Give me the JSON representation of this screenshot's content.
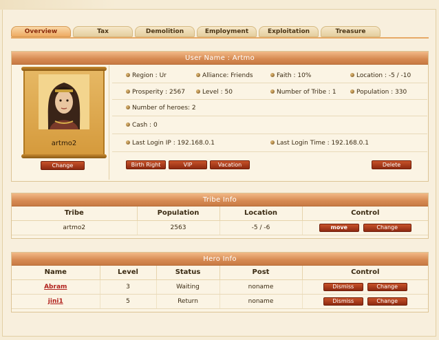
{
  "tabs": [
    "Overview",
    "Tax",
    "Demolition",
    "Employment",
    "Exploitation",
    "Treasure"
  ],
  "user_panel": {
    "header": "User Name : Artmo",
    "player_name": "artmo2",
    "change_label": "Change",
    "fields": {
      "region": "Region : Ur",
      "alliance": "Alliance: Friends",
      "faith": "Faith : 10%",
      "location": "Location : -5 / -10",
      "prosperity": "Prosperity : 2567",
      "level": "Level : 50",
      "num_tribe": "Number of Tribe : 1",
      "population": "Population : 330",
      "heroes": "Number of heroes: 2",
      "cash": "Cash : 0",
      "last_ip": "Last Login IP : 192.168.0.1",
      "last_time": "Last Login Time : 192.168.0.1"
    },
    "buttons": {
      "birth_right": "Birth Right",
      "vip": "VIP",
      "vacation": "Vacation",
      "delete": "Delete"
    }
  },
  "tribe_panel": {
    "header": "Tribe Info",
    "columns": [
      "Tribe",
      "Population",
      "Location",
      "Control"
    ],
    "rows": [
      {
        "tribe": "artmo2",
        "population": "2563",
        "location": "-5 / -6",
        "move": "move",
        "change": "Change"
      }
    ]
  },
  "hero_panel": {
    "header": "Hero Info",
    "columns": [
      "Name",
      "Level",
      "Status",
      "Post",
      "Control"
    ],
    "rows": [
      {
        "name": "Abram",
        "level": "3",
        "status": "Waiting",
        "post": "noname",
        "dismiss": "Dismiss",
        "change": "Change"
      },
      {
        "name": "jini1",
        "level": "5",
        "status": "Return",
        "post": "noname",
        "dismiss": "Dismiss",
        "change": "Change"
      }
    ]
  },
  "colors": {
    "accent": "#d68a52",
    "button": "#a83a18",
    "link": "#b0201c"
  }
}
